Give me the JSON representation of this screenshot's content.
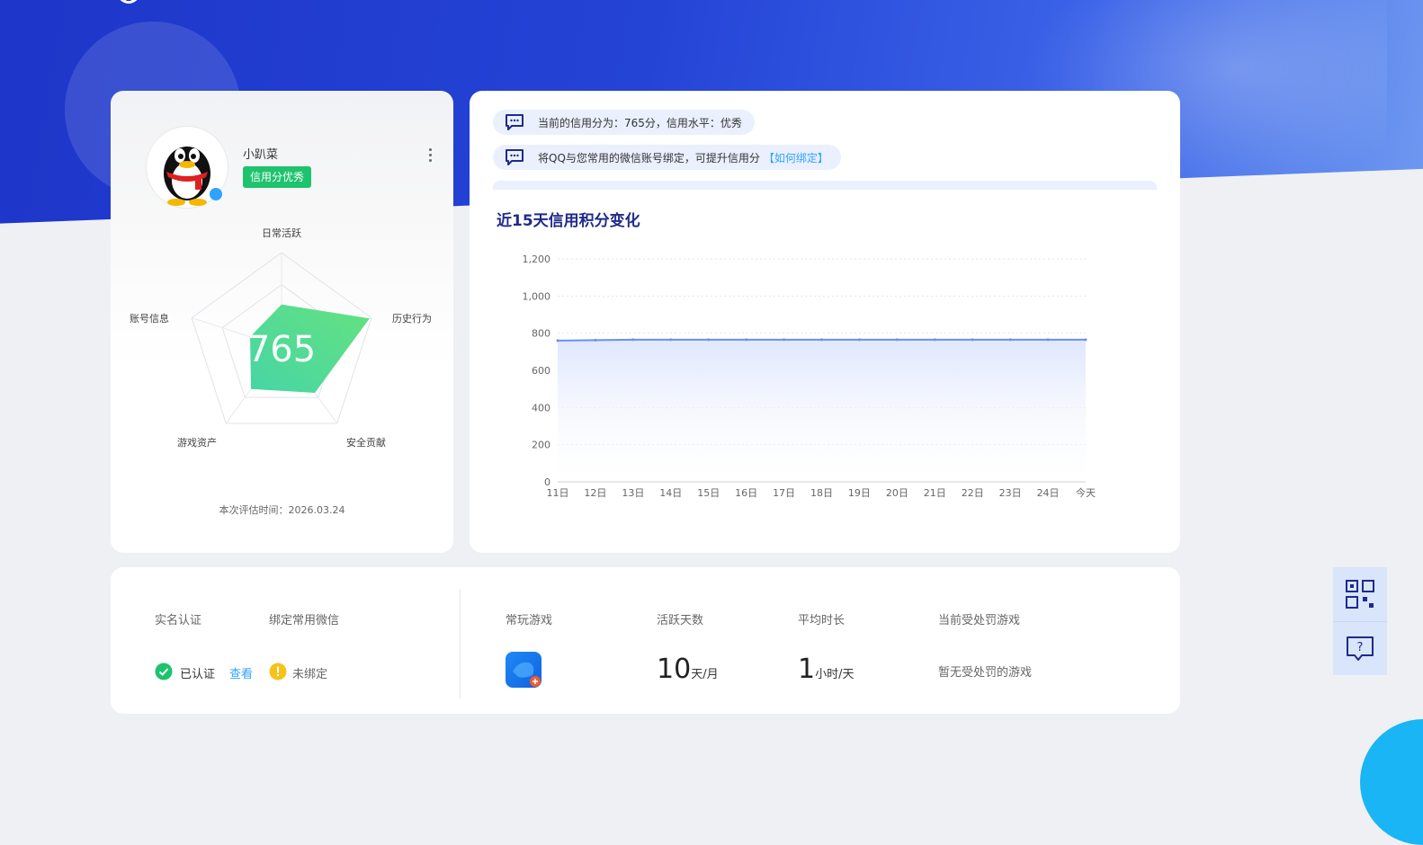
{
  "profile": {
    "username": "小趴菜",
    "credit_badge": "信用分优秀",
    "score": "765",
    "score_value": 765,
    "radar_labels": [
      "日常活跃",
      "历史行为",
      "安全贡献",
      "游戏资产",
      "账号信息"
    ],
    "radar_values": [
      0.45,
      0.98,
      0.6,
      0.55,
      0.35
    ],
    "eval_time": "本次评估时间：2026.03.24"
  },
  "notices": [
    {
      "text": "当前的信用分为：765分，信用水平：优秀",
      "link": ""
    },
    {
      "text": "将QQ与您常用的微信账号绑定，可提升信用分",
      "link": "【如何绑定】"
    }
  ],
  "chart_title": "近15天信用积分变化",
  "chart_data": {
    "type": "area",
    "title": "近15天信用积分变化",
    "x": [
      "11日",
      "12日",
      "13日",
      "14日",
      "15日",
      "16日",
      "17日",
      "18日",
      "19日",
      "20日",
      "21日",
      "22日",
      "23日",
      "24日",
      "今天"
    ],
    "series": [
      {
        "values": [
          760,
          763,
          765,
          765,
          765,
          765,
          765,
          765,
          765,
          765,
          765,
          765,
          765,
          765,
          765
        ]
      }
    ],
    "ylim": [
      0,
      1200
    ],
    "yticks": [
      "0",
      "200",
      "400",
      "600",
      "800",
      "1,000",
      "1,200"
    ],
    "grid": true,
    "colors": {
      "line": "#6c8ef0",
      "fill_top": "#dfe7fd"
    }
  },
  "account": {
    "realname_label": "实名认证",
    "realname_status": "已认证",
    "realname_view": "查看",
    "wechat_label": "绑定常用微信",
    "wechat_status": "未绑定"
  },
  "games": {
    "frequent_label": "常玩游戏",
    "active_days_label": "活跃天数",
    "active_days_value": "10",
    "active_days_unit": "天/月",
    "avg_time_label": "平均时长",
    "avg_time_value": "1",
    "avg_time_unit": "小时/天",
    "punished_label": "当前受处罚游戏",
    "punished_value": "暂无受处罚的游戏"
  },
  "side": {
    "qr_icon": "qr-code-icon",
    "help_icon": "help-chat-icon"
  },
  "colors": {
    "brand_blue": "#2444d6",
    "good_green": "#1ec36d",
    "link_blue": "#2fa3ff",
    "warn_yellow": "#f7c21b"
  }
}
